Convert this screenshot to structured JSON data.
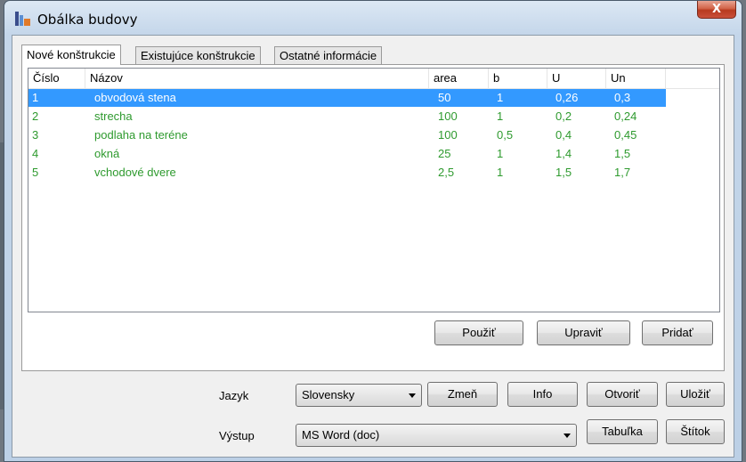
{
  "window": {
    "title": "Obálka budovy",
    "close_glyph": "X"
  },
  "tabs": [
    {
      "label": "Nové konštrukcie",
      "active": true
    },
    {
      "label": "Existujúce konštrukcie",
      "active": false
    },
    {
      "label": "Ostatné informácie",
      "active": false
    }
  ],
  "table": {
    "columns": [
      "Číslo",
      "Názov",
      "area",
      "b",
      "U",
      "Un"
    ],
    "rows": [
      {
        "cislo": "1",
        "nazov": "obvodová stena",
        "area": "50",
        "b": "1",
        "u": "0,26",
        "un": "0,3",
        "selected": true
      },
      {
        "cislo": "2",
        "nazov": "strecha",
        "area": "100",
        "b": "1",
        "u": "0,2",
        "un": "0,24",
        "selected": false
      },
      {
        "cislo": "3",
        "nazov": "podlaha na teréne",
        "area": "100",
        "b": "0,5",
        "u": "0,4",
        "un": "0,45",
        "selected": false
      },
      {
        "cislo": "4",
        "nazov": "okná",
        "area": "25",
        "b": "1",
        "u": "1,4",
        "un": "1,5",
        "selected": false
      },
      {
        "cislo": "5",
        "nazov": "vchodové dvere",
        "area": "2,5",
        "b": "1",
        "u": "1,5",
        "un": "1,7",
        "selected": false
      }
    ],
    "row_text_color": "#2e9a2e",
    "selection_color": "#3399ff"
  },
  "panel_buttons": {
    "pouzit": "Použiť",
    "upravit": "Upraviť",
    "pridat": "Pridať"
  },
  "bottom": {
    "jazyk_label": "Jazyk",
    "jazyk_value": "Slovensky",
    "zmen": "Zmeň",
    "info": "Info",
    "otvorit": "Otvoriť",
    "ulozit": "Uložiť",
    "vystup_label": "Výstup",
    "vystup_value": "MS Word (doc)",
    "tabulka": "Tabuľka",
    "stitok": "Štítok"
  }
}
